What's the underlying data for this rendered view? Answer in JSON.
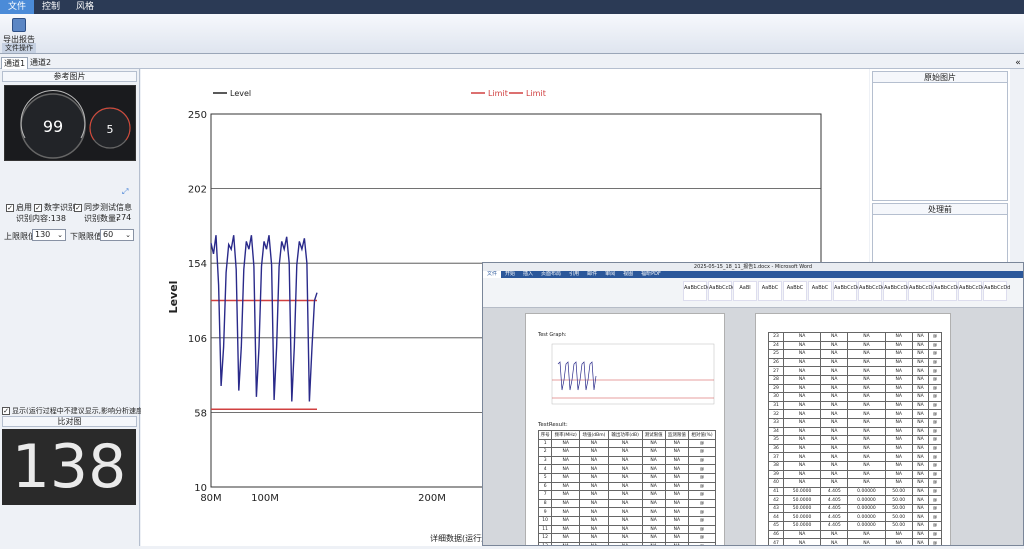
{
  "menubar": {
    "items": [
      "文件",
      "控制",
      "风格"
    ]
  },
  "ribbon": {
    "button_label": "导出报告",
    "group_label": "文件操作"
  },
  "tabs": [
    "通道1",
    "通道2"
  ],
  "left": {
    "ref_title": "参考图片",
    "dash_main": "99",
    "dash_side": "5",
    "enable_label": "启用",
    "digit_label": "数字识别",
    "sync_label": "同步测试信息",
    "recog_content_label": "识别内容:138",
    "recog_count_label": "识别数量:",
    "recog_count": "274",
    "upper_label": "上限限值:",
    "upper_value": "130",
    "lower_label": "下限限值:",
    "lower_value": "60",
    "show_label": "显示(运行过程中不建议显示,影响分析速度)",
    "compare_title": "比对图",
    "compare_value": "138"
  },
  "right": {
    "orig_title": "原始图片",
    "proc_title": "处理前"
  },
  "bottom_text": "详细数据(运行过程",
  "chart_data": {
    "type": "line",
    "ylabel": "Level",
    "ylim": [
      10,
      250
    ],
    "y_ticks": [
      10,
      58,
      106,
      154,
      202,
      250
    ],
    "x_ticks": [
      "80M",
      "100M",
      "200M"
    ],
    "legend": [
      {
        "name": "Level",
        "color": "#222222"
      },
      {
        "name": "Limit",
        "color": "#d04040"
      },
      {
        "name": "Limit",
        "color": "#d04040"
      }
    ],
    "limits": [
      130,
      60
    ],
    "series": [
      {
        "name": "Level",
        "color": "#2a2a8a",
        "points": [
          [
            0,
            167
          ],
          [
            1,
            160
          ],
          [
            2,
            172
          ],
          [
            3,
            140
          ],
          [
            4,
            75
          ],
          [
            5,
            100
          ],
          [
            6,
            148
          ],
          [
            7,
            166
          ],
          [
            8,
            163
          ],
          [
            9,
            172
          ],
          [
            10,
            150
          ],
          [
            11,
            72
          ],
          [
            12,
            100
          ],
          [
            13,
            150
          ],
          [
            14,
            168
          ],
          [
            15,
            163
          ],
          [
            16,
            172
          ],
          [
            17,
            152
          ],
          [
            18,
            68
          ],
          [
            19,
            100
          ],
          [
            20,
            152
          ],
          [
            21,
            168
          ],
          [
            22,
            163
          ],
          [
            23,
            172
          ],
          [
            24,
            153
          ],
          [
            25,
            66
          ],
          [
            26,
            100
          ],
          [
            27,
            152
          ],
          [
            28,
            168
          ],
          [
            29,
            163
          ],
          [
            30,
            171
          ],
          [
            31,
            154
          ],
          [
            32,
            65
          ],
          [
            33,
            100
          ],
          [
            34,
            153
          ],
          [
            35,
            168
          ],
          [
            36,
            163
          ],
          [
            37,
            170
          ],
          [
            38,
            154
          ],
          [
            39,
            65
          ],
          [
            40,
            100
          ],
          [
            41,
            130
          ],
          [
            42,
            135
          ]
        ]
      }
    ]
  },
  "word": {
    "title": "2025-05-15_18_11_报告1.docx - Microsoft Word",
    "tabs": [
      "文件",
      "开始",
      "插入",
      "页面布局",
      "引用",
      "邮件",
      "审阅",
      "视图",
      "福昕PDF"
    ],
    "styles": [
      "AaBbCcDd",
      "AaBbCcDd",
      "AaBl",
      "AaBbC",
      "AaBbC",
      "AaBbC",
      "AaBbCcDd",
      "AaBbCcDd",
      "AaBbCcDd",
      "AaBbCcDd",
      "AaBbCcDd",
      "AaBbCcDd",
      "AaBbCcDd"
    ],
    "test_graph": "Test Graph:",
    "test_result": "TestResult:",
    "headers": [
      "序号",
      "频率(MHz)",
      "场强(dBm)",
      "输出功率(dB)",
      "测试限值",
      "监测限值",
      "相对值(%)"
    ],
    "left_rows": [
      [
        "1",
        "NA",
        "NA",
        "NA",
        "NA",
        "NA",
        "@"
      ],
      [
        "2",
        "NA",
        "NA",
        "NA",
        "NA",
        "NA",
        "@"
      ],
      [
        "3",
        "NA",
        "NA",
        "NA",
        "NA",
        "NA",
        "@"
      ],
      [
        "4",
        "NA",
        "NA",
        "NA",
        "NA",
        "NA",
        "@"
      ],
      [
        "5",
        "NA",
        "NA",
        "NA",
        "NA",
        "NA",
        "@"
      ],
      [
        "6",
        "NA",
        "NA",
        "NA",
        "NA",
        "NA",
        "@"
      ],
      [
        "7",
        "NA",
        "NA",
        "NA",
        "NA",
        "NA",
        "@"
      ],
      [
        "8",
        "NA",
        "NA",
        "NA",
        "NA",
        "NA",
        "@"
      ],
      [
        "9",
        "NA",
        "NA",
        "NA",
        "NA",
        "NA",
        "@"
      ],
      [
        "10",
        "NA",
        "NA",
        "NA",
        "NA",
        "NA",
        "@"
      ],
      [
        "11",
        "NA",
        "NA",
        "NA",
        "NA",
        "NA",
        "@"
      ],
      [
        "12",
        "NA",
        "NA",
        "NA",
        "NA",
        "NA",
        "@"
      ],
      [
        "13",
        "NA",
        "NA",
        "NA",
        "NA",
        "NA",
        "@"
      ]
    ],
    "right_rows": [
      [
        "23",
        "NA",
        "NA",
        "NA",
        "NA",
        "NA",
        "@"
      ],
      [
        "24",
        "NA",
        "NA",
        "NA",
        "NA",
        "NA",
        "@"
      ],
      [
        "25",
        "NA",
        "NA",
        "NA",
        "NA",
        "NA",
        "@"
      ],
      [
        "26",
        "NA",
        "NA",
        "NA",
        "NA",
        "NA",
        "@"
      ],
      [
        "27",
        "NA",
        "NA",
        "NA",
        "NA",
        "NA",
        "@"
      ],
      [
        "28",
        "NA",
        "NA",
        "NA",
        "NA",
        "NA",
        "@"
      ],
      [
        "29",
        "NA",
        "NA",
        "NA",
        "NA",
        "NA",
        "@"
      ],
      [
        "30",
        "NA",
        "NA",
        "NA",
        "NA",
        "NA",
        "@"
      ],
      [
        "31",
        "NA",
        "NA",
        "NA",
        "NA",
        "NA",
        "@"
      ],
      [
        "32",
        "NA",
        "NA",
        "NA",
        "NA",
        "NA",
        "@"
      ],
      [
        "33",
        "NA",
        "NA",
        "NA",
        "NA",
        "NA",
        "@"
      ],
      [
        "34",
        "NA",
        "NA",
        "NA",
        "NA",
        "NA",
        "@"
      ],
      [
        "35",
        "NA",
        "NA",
        "NA",
        "NA",
        "NA",
        "@"
      ],
      [
        "36",
        "NA",
        "NA",
        "NA",
        "NA",
        "NA",
        "@"
      ],
      [
        "37",
        "NA",
        "NA",
        "NA",
        "NA",
        "NA",
        "@"
      ],
      [
        "38",
        "NA",
        "NA",
        "NA",
        "NA",
        "NA",
        "@"
      ],
      [
        "39",
        "NA",
        "NA",
        "NA",
        "NA",
        "NA",
        "@"
      ],
      [
        "40",
        "NA",
        "NA",
        "NA",
        "NA",
        "NA",
        "@"
      ],
      [
        "41",
        "50.0000",
        "4.405",
        "0.00000",
        "50.00",
        "NA",
        "@"
      ],
      [
        "42",
        "50.0000",
        "4.405",
        "0.00000",
        "50.00",
        "NA",
        "@"
      ],
      [
        "43",
        "50.0000",
        "4.405",
        "0.00000",
        "50.00",
        "NA",
        "@"
      ],
      [
        "44",
        "50.0000",
        "4.405",
        "0.00000",
        "50.00",
        "NA",
        "@"
      ],
      [
        "45",
        "50.0000",
        "4.405",
        "0.00000",
        "50.00",
        "NA",
        "@"
      ],
      [
        "46",
        "NA",
        "NA",
        "NA",
        "NA",
        "NA",
        "@"
      ],
      [
        "47",
        "NA",
        "NA",
        "NA",
        "NA",
        "NA",
        "@"
      ],
      [
        "48",
        "50.0000",
        "4.295",
        "0.00000",
        "50.00",
        "NA",
        "@"
      ]
    ]
  }
}
